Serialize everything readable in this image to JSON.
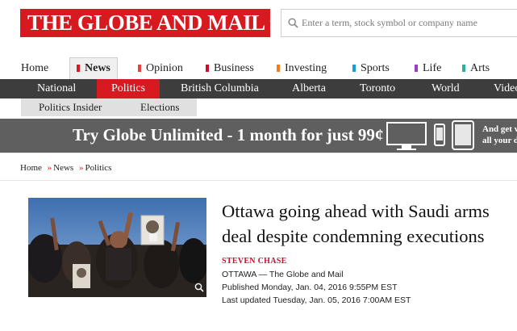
{
  "header": {
    "logo_text": "THE GLOBE AND MAIL",
    "search_placeholder": "Enter a term, stock symbol or company name"
  },
  "sections": [
    {
      "label": "Home",
      "color": ""
    },
    {
      "label": "News",
      "color": "#d71920"
    },
    {
      "label": "Opinion",
      "color": "#e8403a"
    },
    {
      "label": "Business",
      "color": "#c8102e"
    },
    {
      "label": "Investing",
      "color": "#f47b20"
    },
    {
      "label": "Sports",
      "color": "#1b9ad6"
    },
    {
      "label": "Life",
      "color": "#9b3ec7"
    },
    {
      "label": "Arts",
      "color": "#26b39a"
    }
  ],
  "subnav": [
    "National",
    "Politics",
    "British Columbia",
    "Alberta",
    "Toronto",
    "World",
    "Video"
  ],
  "subsubnav": [
    "Politics Insider",
    "Elections"
  ],
  "promo": {
    "text": "Try Globe Unlimited - 1 month for just 99¢",
    "side_line1": "And get w",
    "side_line2": "all your d"
  },
  "breadcrumb": [
    "Home",
    "News",
    "Politics"
  ],
  "breadcrumb_separator": "»",
  "article": {
    "headline": "Ottawa going ahead with Saudi arms deal despite condemning executions",
    "author": "STEVEN CHASE",
    "dateline": "OTTAWA — The Globe and Mail",
    "published": "Published Monday, Jan. 04, 2016 9:55PM EST",
    "updated": "Last updated Tuesday, Jan. 05, 2016 7:00AM EST"
  },
  "icons": {
    "search": "search-icon",
    "maple_leaf": "maple-leaf-icon",
    "zoom": "zoom-icon"
  },
  "colors": {
    "brand_red": "#d71920",
    "subnav_bg": "#3d3d3d",
    "promo_bg": "#5f5f5f"
  }
}
